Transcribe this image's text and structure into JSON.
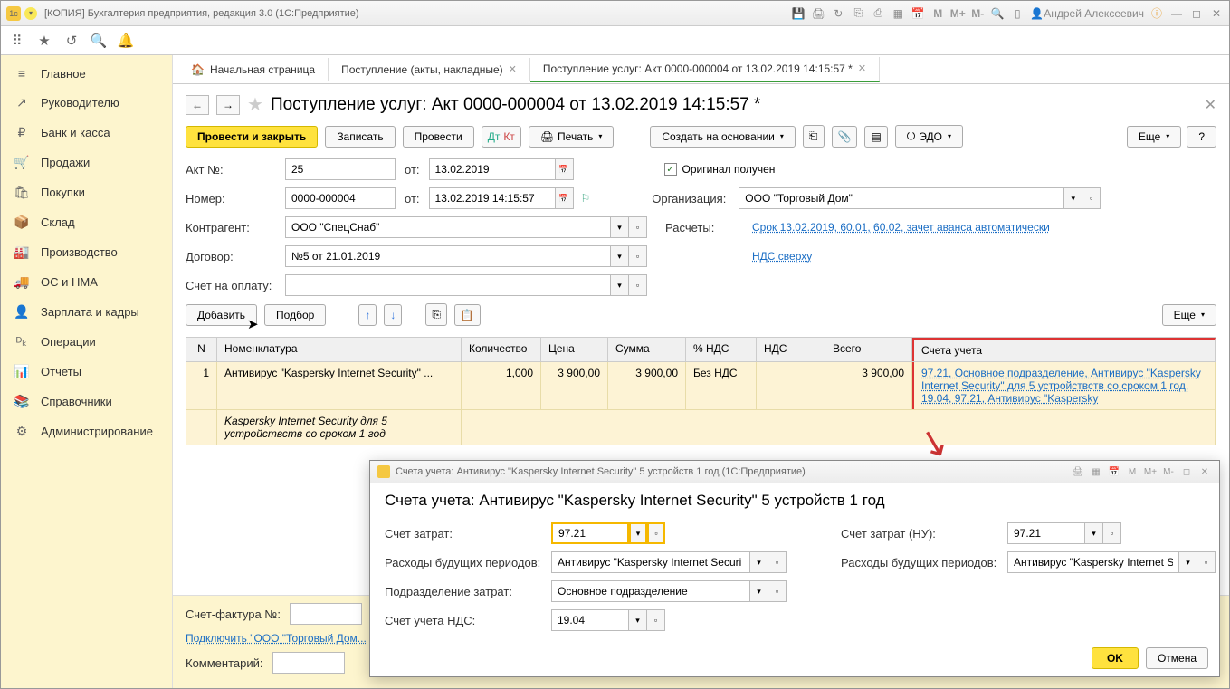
{
  "title": "[КОПИЯ] Бухгалтерия предприятия, редакция 3.0  (1С:Предприятие)",
  "user": "Андрей Алексеевич",
  "mbuttons": {
    "m": "M",
    "mp": "M+",
    "mm": "M-"
  },
  "sidebar": {
    "items": [
      {
        "icon": "≡",
        "label": "Главное"
      },
      {
        "icon": "↗",
        "label": "Руководителю"
      },
      {
        "icon": "₽",
        "label": "Банк и касса"
      },
      {
        "icon": "🛒",
        "label": "Продажи"
      },
      {
        "icon": "🛍",
        "label": "Покупки"
      },
      {
        "icon": "📦",
        "label": "Склад"
      },
      {
        "icon": "🏭",
        "label": "Производство"
      },
      {
        "icon": "🚚",
        "label": "ОС и НМА"
      },
      {
        "icon": "👤",
        "label": "Зарплата и кадры"
      },
      {
        "icon": "ᴰₖ",
        "label": "Операции"
      },
      {
        "icon": "📊",
        "label": "Отчеты"
      },
      {
        "icon": "📚",
        "label": "Справочники"
      },
      {
        "icon": "⚙",
        "label": "Администрирование"
      }
    ]
  },
  "tabs": [
    {
      "icon": "🏠",
      "label": "Начальная страница",
      "active": false,
      "closable": false
    },
    {
      "icon": "",
      "label": "Поступление (акты, накладные)",
      "active": false,
      "closable": true
    },
    {
      "icon": "",
      "label": "Поступление услуг: Акт 0000-000004 от 13.02.2019 14:15:57 *",
      "active": true,
      "closable": true
    }
  ],
  "page": {
    "title": "Поступление услуг: Акт 0000-000004 от 13.02.2019 14:15:57 *",
    "buttons": {
      "post_close": "Провести и закрыть",
      "write": "Записать",
      "post": "Провести",
      "print": "Печать",
      "create_based": "Создать на основании",
      "edo": "ЭДО",
      "more": "Еще",
      "help": "?"
    },
    "labels": {
      "act_no": "Акт №:",
      "from": "от:",
      "number": "Номер:",
      "counteragent": "Контрагент:",
      "contract": "Договор:",
      "invoice": "Счет на оплату:",
      "original": "Оригинал получен",
      "organization": "Организация:",
      "calculations": "Расчеты:",
      "add": "Добавить",
      "select": "Подбор",
      "more2": "Еще"
    },
    "values": {
      "act_no": "25",
      "act_date": "13.02.2019",
      "number": "0000-000004",
      "number_date": "13.02.2019 14:15:57",
      "counteragent": "ООО \"СпецСнаб\"",
      "contract": "№5 от 21.01.2019",
      "invoice": "",
      "organization": "ООО \"Торговый Дом\"",
      "calc_link": "Срок 13.02.2019, 60.01, 60.02, зачет аванса автоматически",
      "vat_link": "НДС сверху"
    },
    "table": {
      "headers": [
        "N",
        "Номенклатура",
        "Количество",
        "Цена",
        "Сумма",
        "% НДС",
        "НДС",
        "Всего",
        "Счета учета"
      ],
      "row": {
        "n": "1",
        "nomenclature": "Антивирус \"Kaspersky Internet Security\" ...",
        "desc": "Kaspersky Internet Security для 5 устройствств со сроком 1 год",
        "qty": "1,000",
        "price": "3 900,00",
        "sum": "3 900,00",
        "vat_pct": "Без НДС",
        "vat": "",
        "total": "3 900,00",
        "accounts": "97.21, Основное подразделение, Антивирус \"Kaspersky Internet Security\" для 5 устройствств со сроком 1 год, 19.04, 97.21, Антивирус \"Kaspersky "
      }
    }
  },
  "bottom": {
    "invoice_label": "Счет-фактура №:",
    "connect_link": "Подключить \"ООО \"Торговый Дом...",
    "comment_label": "Комментарий:"
  },
  "dialog": {
    "titlebar": "Счета учета: Антивирус \"Kaspersky Internet Security\" 5 устройств  1 год  (1С:Предприятие)",
    "heading": "Счета учета: Антивирус \"Kaspersky Internet Security\" 5 устройств  1 год",
    "labels": {
      "cost_account": "Счет затрат:",
      "cost_account_nu": "Счет затрат (НУ):",
      "deferred": "Расходы будущих периодов:",
      "department": "Подразделение затрат:",
      "vat_account": "Счет учета НДС:"
    },
    "values": {
      "cost_account": "97.21",
      "cost_account_nu": "97.21",
      "deferred1": "Антивирус \"Kaspersky Internet Securi",
      "deferred2": "Антивирус \"Kaspersky Internet S",
      "department": "Основное подразделение",
      "vat_account": "19.04"
    },
    "buttons": {
      "ok": "OK",
      "cancel": "Отмена"
    }
  }
}
